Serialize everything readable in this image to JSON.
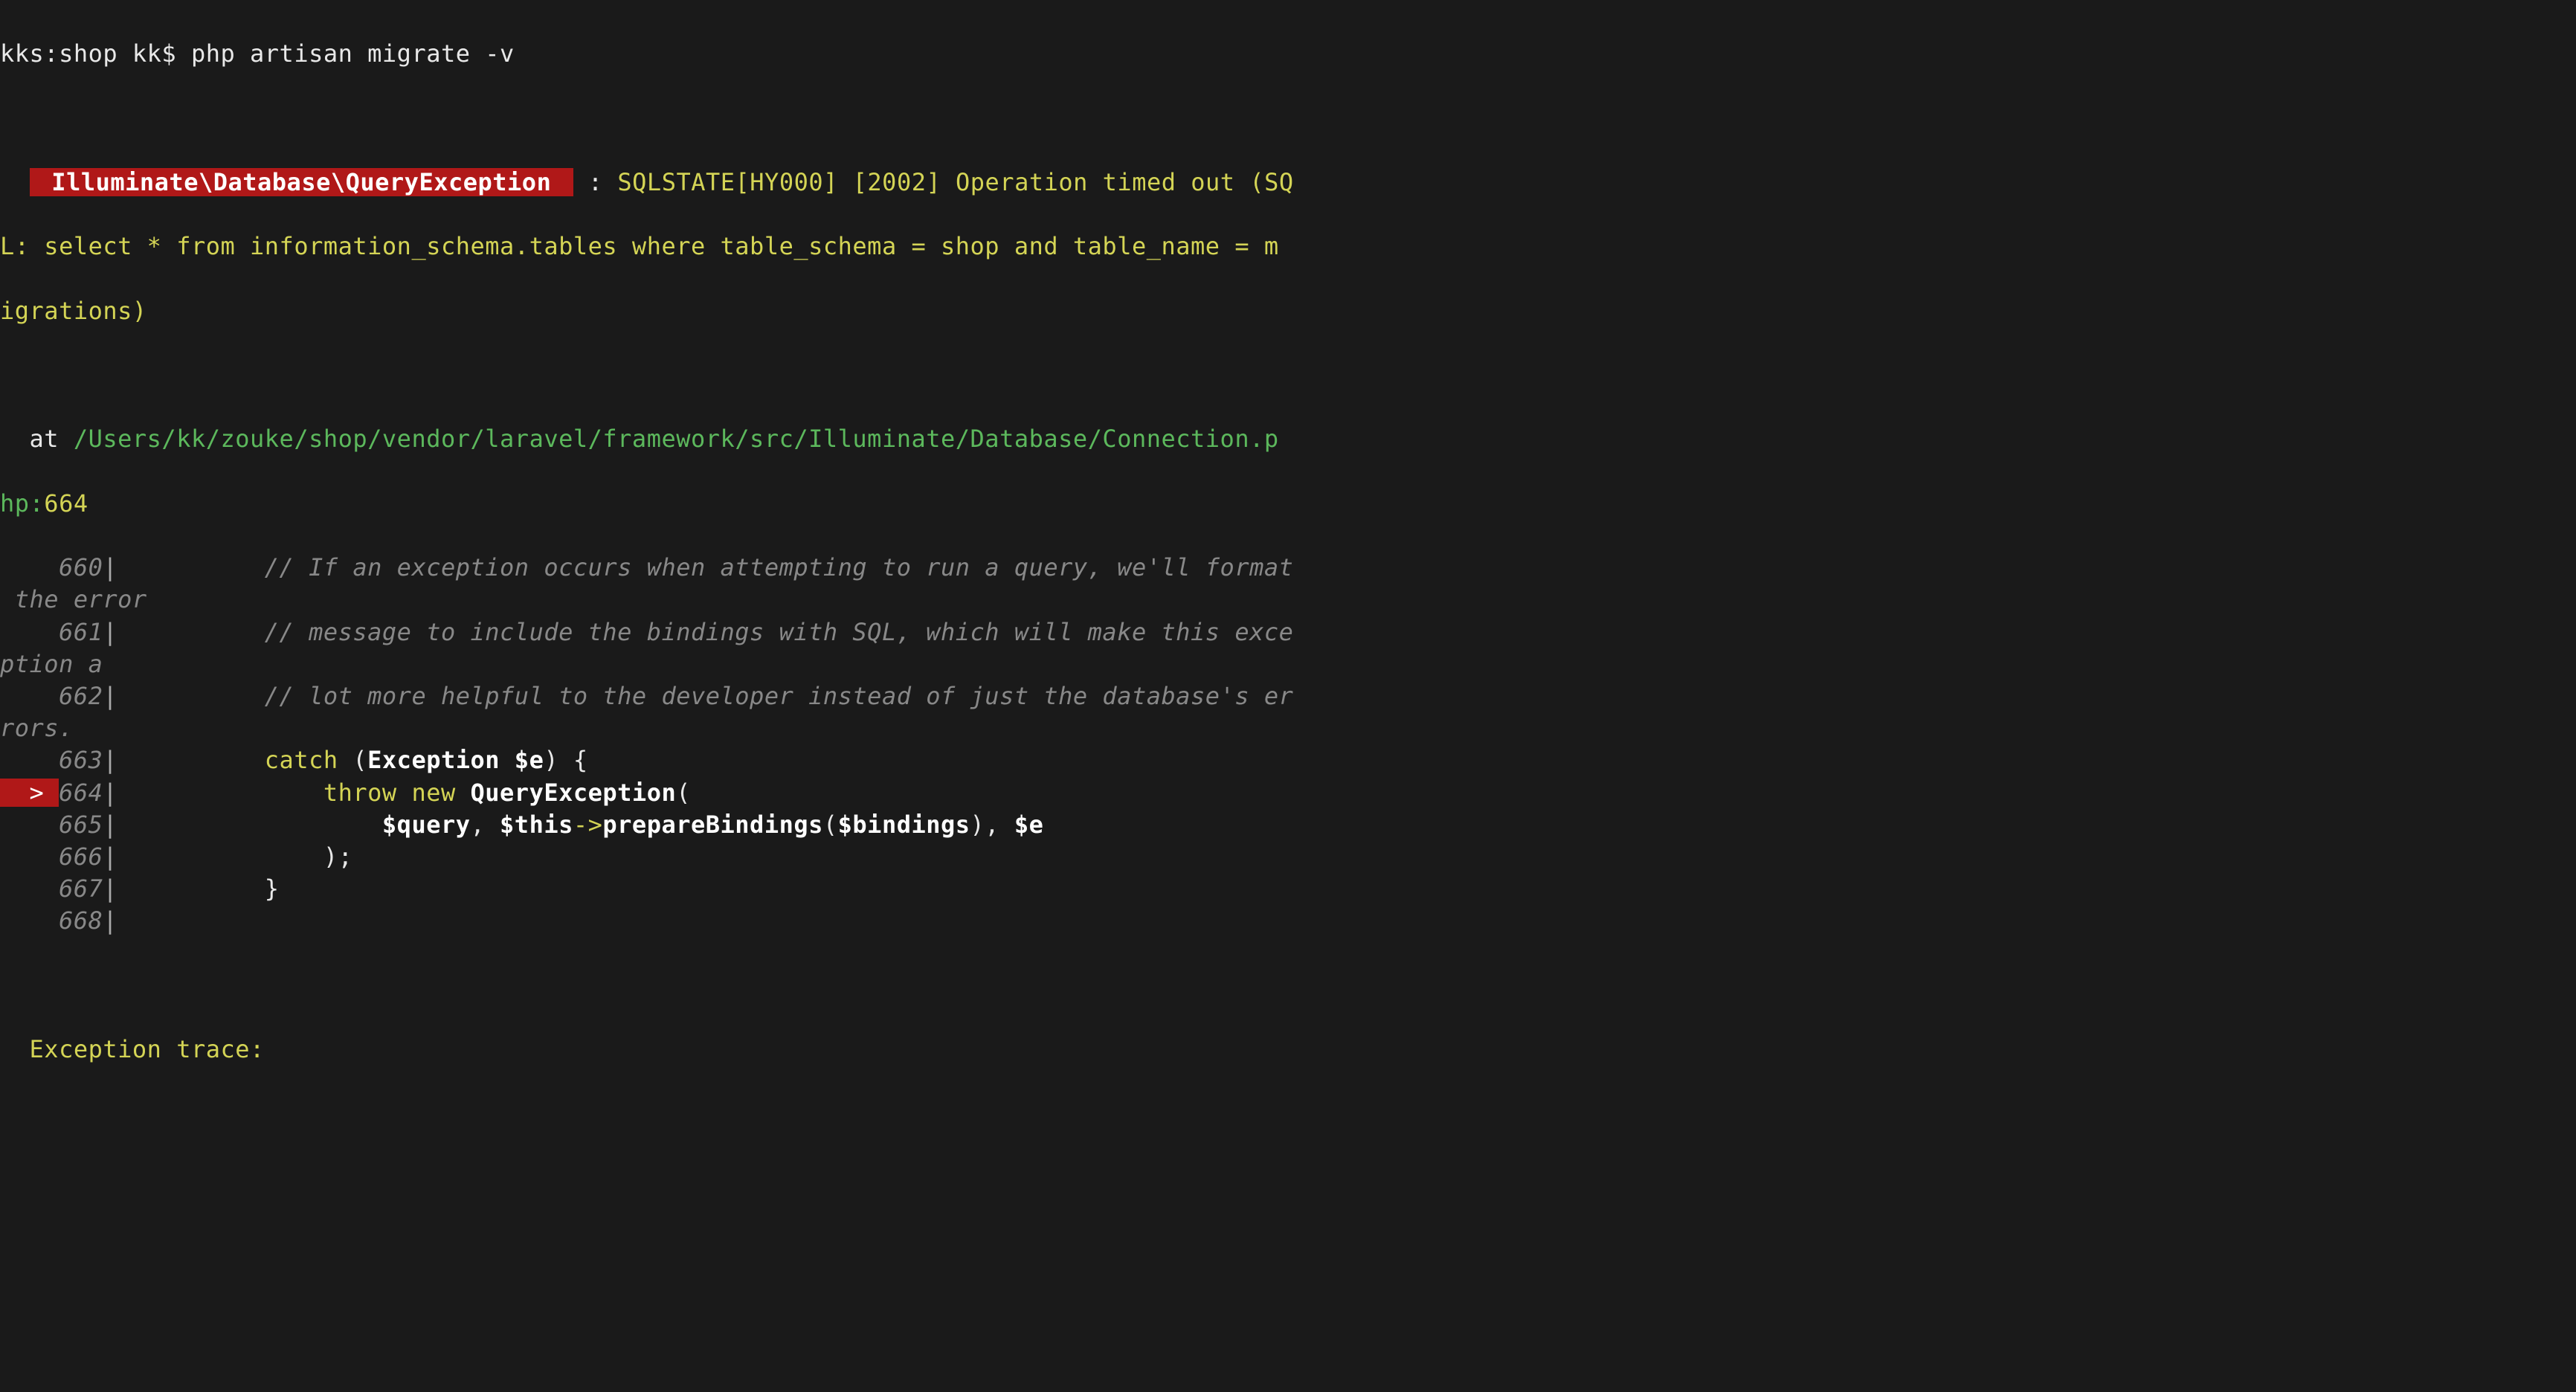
{
  "prompt": {
    "host": "kks:shop kk$",
    "command": " php artisan migrate -v"
  },
  "exception": {
    "class": " Illuminate\\Database\\QueryException ",
    "separator": " : ",
    "message_l1": "SQLSTATE[HY000] [2002] Operation timed out (SQ",
    "message_l2": "L: select * from information_schema.tables where table_schema = shop and table_name = m",
    "message_l3": "igrations)"
  },
  "location": {
    "at": "  at ",
    "path_l1": "/Users/kk/zouke/shop/vendor/laravel/framework/src/Illuminate/Database/Connection.p",
    "path_l2": "hp",
    "colon": ":",
    "line": "664"
  },
  "code": {
    "lines": [
      {
        "no": "660",
        "marker": "    ",
        "segments": [
          {
            "t": "comment",
            "v": "         // If an exception occurs when attempting to run a query, we'll format"
          }
        ]
      },
      {
        "cont": true,
        "segments": [
          {
            "t": "comment",
            "v": " the error"
          }
        ]
      },
      {
        "no": "661",
        "marker": "    ",
        "segments": [
          {
            "t": "comment",
            "v": "         // message to include the bindings with SQL, which will make this exce"
          }
        ]
      },
      {
        "cont": true,
        "segments": [
          {
            "t": "comment",
            "v": "ption a"
          }
        ]
      },
      {
        "no": "662",
        "marker": "    ",
        "segments": [
          {
            "t": "comment",
            "v": "         // lot more helpful to the developer instead of just the database's er"
          }
        ]
      },
      {
        "cont": true,
        "segments": [
          {
            "t": "comment",
            "v": "rors."
          }
        ]
      },
      {
        "no": "663",
        "marker": "    ",
        "segments": [
          {
            "t": "plain",
            "v": "         "
          },
          {
            "t": "keyword",
            "v": "catch"
          },
          {
            "t": "plain",
            "v": " ("
          },
          {
            "t": "identifier",
            "v": "Exception $e"
          },
          {
            "t": "plain",
            "v": ") {"
          }
        ]
      },
      {
        "no": "664",
        "marker": "  > ",
        "err": true,
        "segments": [
          {
            "t": "plain",
            "v": "             "
          },
          {
            "t": "keyword",
            "v": "throw new"
          },
          {
            "t": "plain",
            "v": " "
          },
          {
            "t": "identifier",
            "v": "QueryException"
          },
          {
            "t": "plain",
            "v": "("
          }
        ]
      },
      {
        "no": "665",
        "marker": "    ",
        "segments": [
          {
            "t": "plain",
            "v": "                 "
          },
          {
            "t": "var",
            "v": "$query"
          },
          {
            "t": "plain",
            "v": ", "
          },
          {
            "t": "var",
            "v": "$this"
          },
          {
            "t": "arrow",
            "v": "->"
          },
          {
            "t": "bold-white",
            "v": "prepareBindings"
          },
          {
            "t": "plain",
            "v": "("
          },
          {
            "t": "var",
            "v": "$bindings"
          },
          {
            "t": "plain",
            "v": "), "
          },
          {
            "t": "var",
            "v": "$e"
          }
        ]
      },
      {
        "no": "666",
        "marker": "    ",
        "segments": [
          {
            "t": "plain",
            "v": "             );"
          }
        ]
      },
      {
        "no": "667",
        "marker": "    ",
        "segments": [
          {
            "t": "plain",
            "v": "         }"
          }
        ]
      },
      {
        "no": "668",
        "marker": "    ",
        "segments": []
      }
    ]
  },
  "trace": {
    "label": "  Exception trace:"
  }
}
